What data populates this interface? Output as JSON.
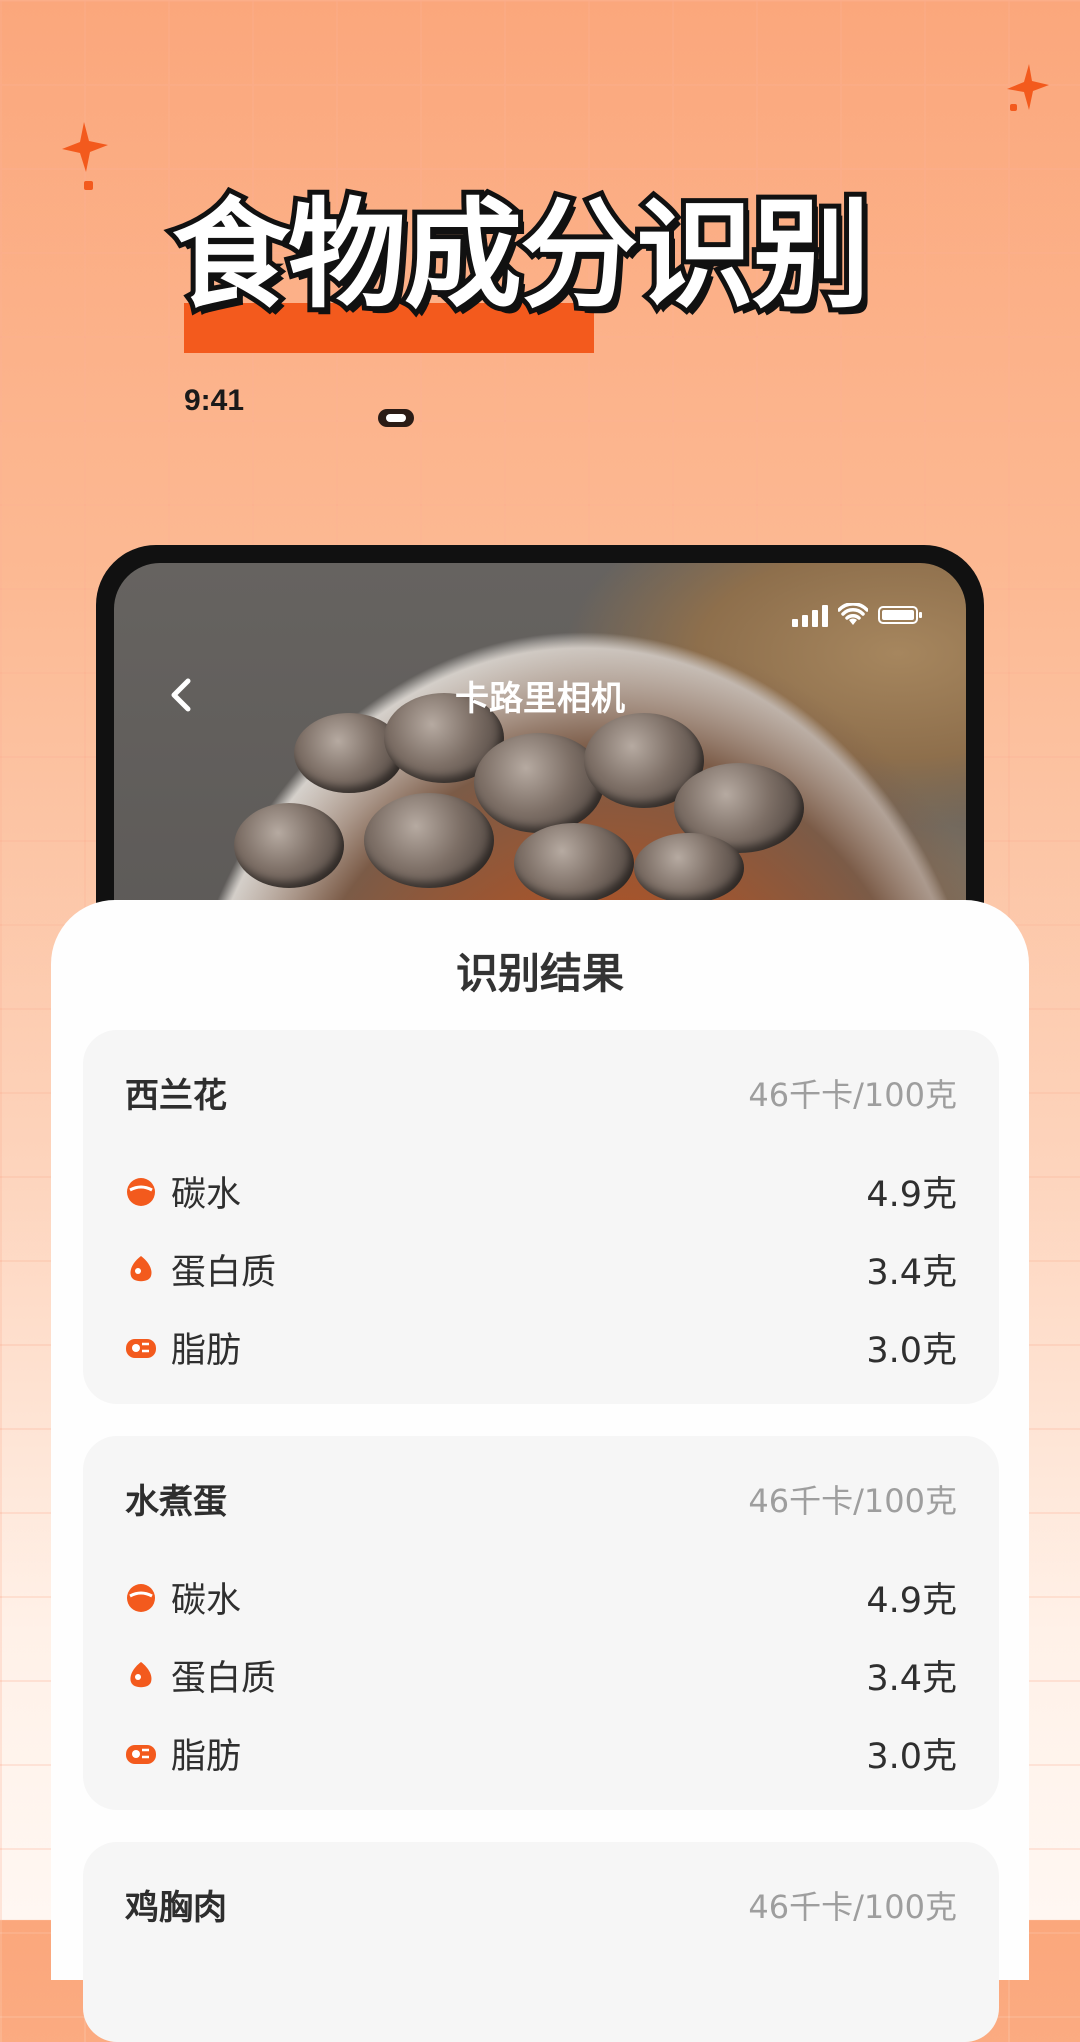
{
  "promo": {
    "headline": "食物成分识别",
    "time": "9:41"
  },
  "camera": {
    "title": "卡路里相机",
    "back_icon": "chevron-left-icon",
    "status_icons": [
      "signal-icon",
      "wifi-icon",
      "battery-icon"
    ]
  },
  "result": {
    "title": "识别结果",
    "foods": [
      {
        "name": "西兰花",
        "calories": "46千卡/100克",
        "nutrients": [
          {
            "label": "碳水",
            "value": "4.9克",
            "icon": "carb-icon"
          },
          {
            "label": "蛋白质",
            "value": "3.4克",
            "icon": "protein-icon"
          },
          {
            "label": "脂肪",
            "value": "3.0克",
            "icon": "fat-icon"
          }
        ]
      },
      {
        "name": "水煮蛋",
        "calories": "46千卡/100克",
        "nutrients": [
          {
            "label": "碳水",
            "value": "4.9克",
            "icon": "carb-icon"
          },
          {
            "label": "蛋白质",
            "value": "3.4克",
            "icon": "protein-icon"
          },
          {
            "label": "脂肪",
            "value": "3.0克",
            "icon": "fat-icon"
          }
        ]
      },
      {
        "name": "鸡胸肉",
        "calories": "46千卡/100克",
        "nutrients": []
      }
    ]
  },
  "colors": {
    "accent": "#f35a1d",
    "sheet": "#fefefe",
    "card": "#f6f6f6"
  }
}
